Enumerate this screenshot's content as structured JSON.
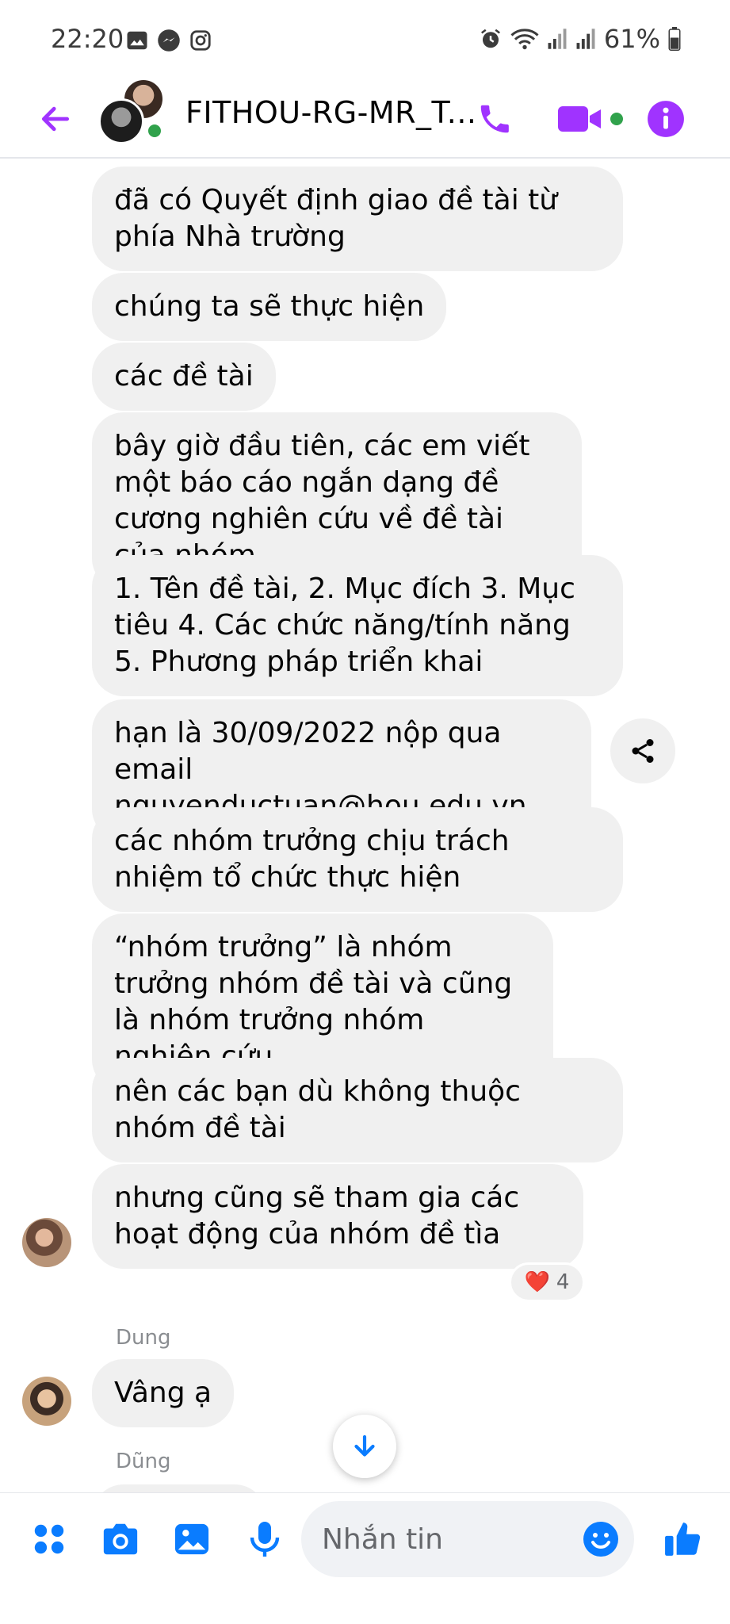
{
  "status_bar": {
    "time": "22:20",
    "battery": "61%"
  },
  "header": {
    "title": "FITHOU-RG-MR_T..."
  },
  "colors": {
    "accent": "#a033ff",
    "bubble_bg": "#f0f0f0",
    "online": "#31a24c",
    "messenger_blue": "#0a7cff"
  },
  "messages": [
    {
      "text": "đã có Quyết định giao đề tài từ phía Nhà trường"
    },
    {
      "text": "chúng ta sẽ thực hiện"
    },
    {
      "text": "các đề tài"
    },
    {
      "text": "bây giờ đầu tiên, các em viết một báo cáo ngắn dạng đề cương nghiên cứu về đề tài của nhóm"
    },
    {
      "text": "1. Tên đề tài, 2. Mục đích 3. Mục tiêu 4. Các chức năng/tính năng 5. Phương pháp triển khai"
    },
    {
      "text": "hạn là 30/09/2022 nộp qua email",
      "link": "nguyenductuan@hou.edu.vn"
    },
    {
      "text": "các nhóm trưởng chịu trách nhiệm tổ chức thực hiện"
    },
    {
      "text": "“nhóm trưởng” là nhóm trưởng nhóm đề tài và cũng là nhóm trưởng nhóm nghiên cứu"
    },
    {
      "text": "nên các bạn dù không thuộc nhóm đề tài"
    },
    {
      "text": "nhưng cũng sẽ tham gia các hoạt động của nhóm đề tìa"
    }
  ],
  "reaction": {
    "emoji": "❤️",
    "count": "4"
  },
  "reply_1": {
    "sender": "Dung",
    "text": "Vâng ạ"
  },
  "reply_2": {
    "sender": "Dũng"
  },
  "composer": {
    "placeholder": "Nhắn tin"
  },
  "icons": {
    "back": "arrow-left-icon",
    "call": "phone-icon",
    "video": "video-camera-icon",
    "info": "info-icon",
    "share": "share-icon",
    "scroll": "arrow-down-icon",
    "apps": "grid-dots-icon",
    "camera": "camera-icon",
    "gallery": "image-icon",
    "mic": "microphone-icon",
    "emoji": "smiley-icon",
    "like": "thumbs-up-icon"
  }
}
